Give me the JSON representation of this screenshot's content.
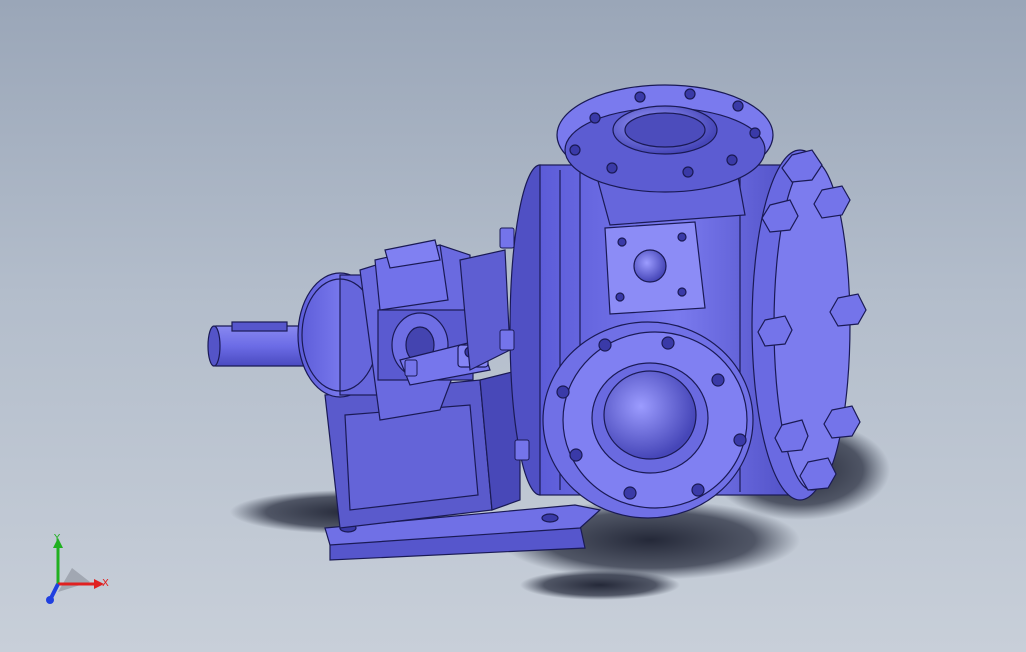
{
  "triad": {
    "x_label": "X",
    "y_label": "Y",
    "colors": {
      "x": "#e02020",
      "y": "#20b020",
      "z": "#2040e0"
    }
  },
  "model": {
    "body_color": "#6b6be6",
    "edge_color": "#1a1a55",
    "icon": "gear-pump-3d-model"
  }
}
